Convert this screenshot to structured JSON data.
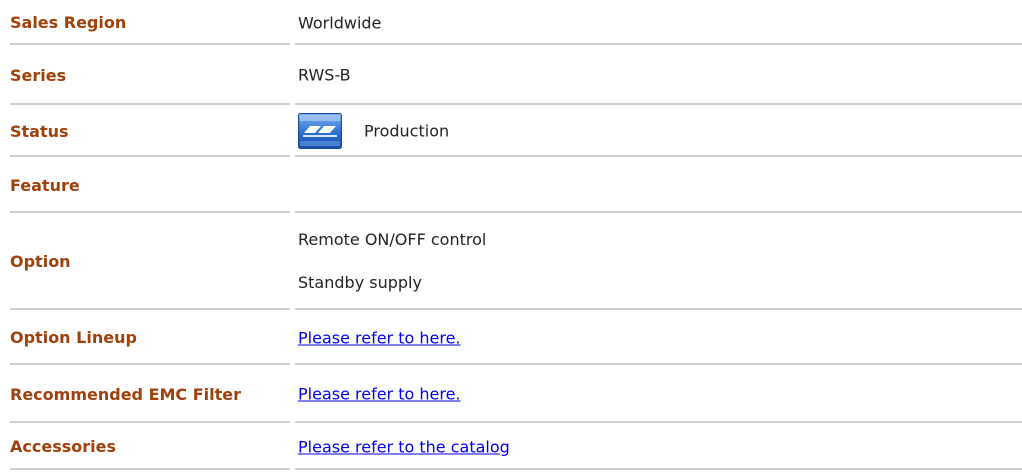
{
  "rows": [
    {
      "label": "Sales Region",
      "value": "Worldwide"
    },
    {
      "label": "Series",
      "value": "RWS-B"
    },
    {
      "label": "Status",
      "value": "Production",
      "icon": "production-status-icon"
    },
    {
      "label": "Feature",
      "value": ""
    },
    {
      "label": "Option",
      "values": [
        "Remote ON/OFF control",
        "Standby supply"
      ]
    },
    {
      "label": "Option Lineup",
      "link": "Please refer to here."
    },
    {
      "label": "Recommended EMC Filter",
      "link": "Please refer to here."
    },
    {
      "label": "Accessories",
      "link": "Please refer to the catalog"
    }
  ],
  "colors": {
    "label": "#a0400a",
    "link": "#0000ee",
    "divider": "#cfcfcf",
    "icon_blue": "#3a78c8"
  }
}
